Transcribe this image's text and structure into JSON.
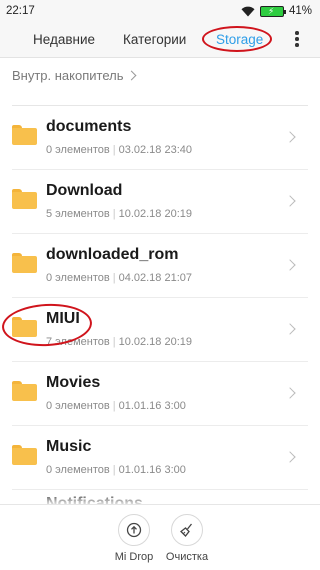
{
  "status_bar": {
    "time": "22:17",
    "battery": "41%"
  },
  "tabs": [
    {
      "label": "Недавние",
      "active": false
    },
    {
      "label": "Категории",
      "active": false
    },
    {
      "label": "Storage",
      "active": true
    }
  ],
  "breadcrumb": {
    "location": "Внутр. накопитель"
  },
  "folders": [
    {
      "name": "documents",
      "count": "0 элементов",
      "date": "03.02.18 23:40"
    },
    {
      "name": "Download",
      "count": "5 элементов",
      "date": "10.02.18 20:19"
    },
    {
      "name": "downloaded_rom",
      "count": "0 элементов",
      "date": "04.02.18 21:07"
    },
    {
      "name": "MIUI",
      "count": "7 элементов",
      "date": "10.02.18 20:19"
    },
    {
      "name": "Movies",
      "count": "0 элементов",
      "date": "01.01.16 3:00"
    },
    {
      "name": "Music",
      "count": "0 элементов",
      "date": "01.01.16 3:00"
    },
    {
      "name": "Notifications",
      "count": "",
      "date": ""
    }
  ],
  "bottom_actions": [
    {
      "label": "Mi Drop",
      "icon": "mi-drop-icon"
    },
    {
      "label": "Очистка",
      "icon": "broom-icon"
    }
  ],
  "colors": {
    "accent": "#2f9ee8",
    "folder": "#f8c04c",
    "annotation": "#d0141c",
    "battery": "#2ecc40"
  }
}
